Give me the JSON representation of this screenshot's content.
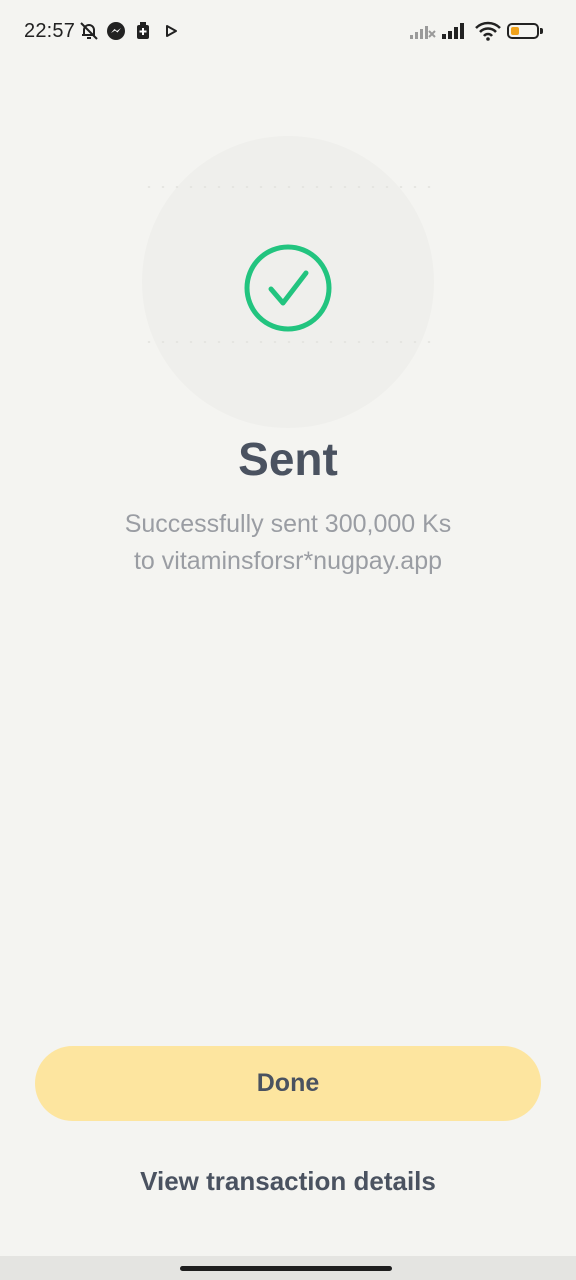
{
  "status_bar": {
    "time": "22:57",
    "icons": [
      "bell-off-icon",
      "messenger-icon",
      "battery-saver-icon",
      "play-icon",
      "signal-x-icon",
      "signal-icon",
      "wifi-icon",
      "battery-icon"
    ],
    "battery_level": 0.35
  },
  "success": {
    "icon": "check-circle-icon",
    "title": "Sent",
    "message_line1": "Successfully sent 300,000 Ks",
    "message_line2": "to vitaminsforsr*nugpay.app"
  },
  "actions": {
    "done_label": "Done",
    "details_label": "View transaction details"
  },
  "colors": {
    "background": "#f4f4f1",
    "accent_button": "#fde59f",
    "success_green": "#22c47f",
    "text_dark": "#4a5260",
    "text_muted": "#9a9da3"
  }
}
